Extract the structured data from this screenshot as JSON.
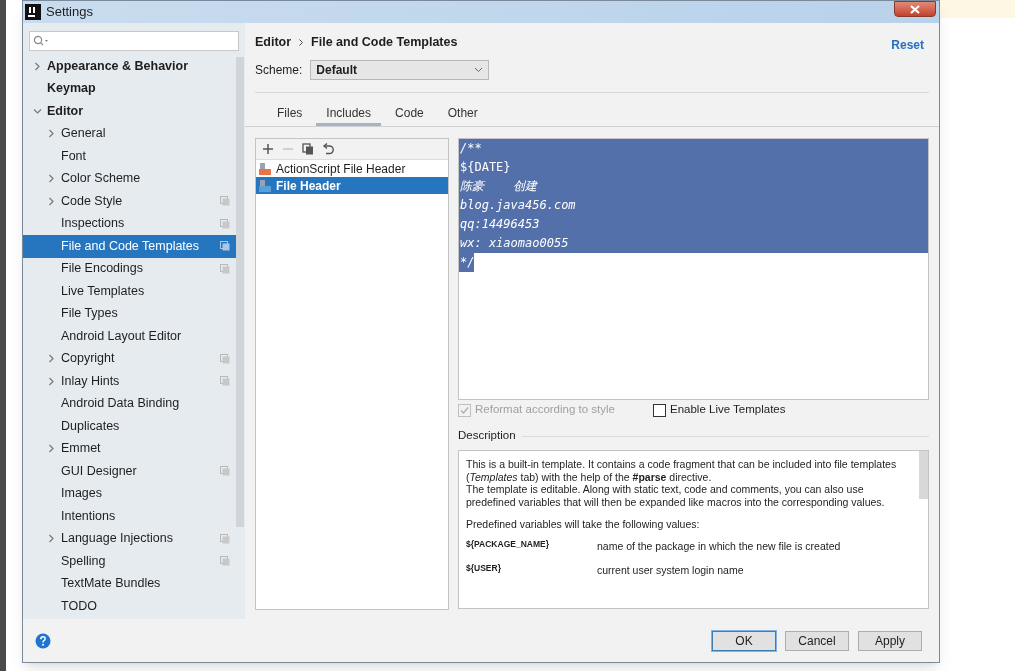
{
  "window": {
    "title": "Settings"
  },
  "sidebar": {
    "items": [
      {
        "label": "Appearance & Behavior",
        "selected": false,
        "expanded": false
      },
      {
        "label": "Keymap",
        "selected": false
      },
      {
        "label": "Editor",
        "selected": false,
        "expanded": true,
        "children": [
          {
            "label": "General",
            "selected": false,
            "expanded": false
          },
          {
            "label": "Font",
            "selected": false
          },
          {
            "label": "Color Scheme",
            "selected": false,
            "expanded": false
          },
          {
            "label": "Code Style",
            "selected": false,
            "expanded": false,
            "project_level": true
          },
          {
            "label": "Inspections",
            "selected": false,
            "project_level": true
          },
          {
            "label": "File and Code Templates",
            "selected": true,
            "project_level": true
          },
          {
            "label": "File Encodings",
            "selected": false,
            "project_level": true
          },
          {
            "label": "Live Templates",
            "selected": false
          },
          {
            "label": "File Types",
            "selected": false
          },
          {
            "label": "Android Layout Editor",
            "selected": false
          },
          {
            "label": "Copyright",
            "selected": false,
            "expanded": false,
            "project_level": true
          },
          {
            "label": "Inlay Hints",
            "selected": false,
            "expanded": false,
            "project_level": true
          },
          {
            "label": "Android Data Binding",
            "selected": false
          },
          {
            "label": "Duplicates",
            "selected": false
          },
          {
            "label": "Emmet",
            "selected": false,
            "expanded": false
          },
          {
            "label": "GUI Designer",
            "selected": false,
            "project_level": true
          },
          {
            "label": "Images",
            "selected": false
          },
          {
            "label": "Intentions",
            "selected": false
          },
          {
            "label": "Language Injections",
            "selected": false,
            "expanded": false,
            "project_level": true
          },
          {
            "label": "Spelling",
            "selected": false,
            "project_level": true
          },
          {
            "label": "TextMate Bundles",
            "selected": false
          },
          {
            "label": "TODO",
            "selected": false
          }
        ]
      }
    ]
  },
  "breadcrumb": [
    "Editor",
    "File and Code Templates"
  ],
  "reset": "Reset",
  "scheme": {
    "label": "Scheme:",
    "value": "Default"
  },
  "tabs": [
    {
      "label": "Files",
      "selected": false
    },
    {
      "label": "Includes",
      "selected": true
    },
    {
      "label": "Code",
      "selected": false
    },
    {
      "label": "Other",
      "selected": false
    }
  ],
  "toolbar": [
    {
      "kind": "add",
      "disabled": false
    },
    {
      "kind": "remove",
      "disabled": true
    },
    {
      "kind": "copy",
      "disabled": false
    },
    {
      "kind": "reset",
      "disabled": false
    }
  ],
  "templates": [
    {
      "name": "ActionScript File Header",
      "kind": "actionscript",
      "selected": false
    },
    {
      "name": "File Header",
      "kind": "java",
      "selected": true
    }
  ],
  "editor": {
    "lines": [
      {
        "text": "/**",
        "kind": "comment",
        "selected": true,
        "whole_line": true
      },
      {
        "text": "${DATE}",
        "kind": "variable",
        "selected": true,
        "whole_line": true
      },
      {
        "text": "陈豪    创建",
        "kind": "comment",
        "selected": true,
        "whole_line": true
      },
      {
        "text": "blog.java456.com",
        "kind": "comment",
        "selected": true,
        "whole_line": true
      },
      {
        "text": "qq:14496453",
        "kind": "comment",
        "selected": true,
        "whole_line": true
      },
      {
        "text": "wx: xiaomao0055",
        "kind": "comment",
        "selected": true,
        "whole_line": true
      },
      {
        "text": "*/",
        "kind": "comment",
        "selected": true,
        "whole_line": false
      }
    ]
  },
  "options": [
    {
      "label": "Reformat according to style",
      "checked": true,
      "disabled": true
    },
    {
      "label": "Enable Live Templates",
      "checked": false,
      "disabled": false
    }
  ],
  "description": {
    "title": "Description",
    "paragraphs": [
      "This is a built-in template. It contains a code fragment that can be included into file templates (*Templates* tab) with the help of the **#parse** directive.",
      "The template is editable. Along with static text, code and comments, you can also use predefined variables that will then be expanded like macros into the corresponding values.",
      "Predefined variables will take the following values:"
    ],
    "variables": [
      {
        "name": "${PACKAGE_NAME}",
        "text": "name of the package in which the new file is created"
      },
      {
        "name": "${USER}",
        "text": "current user system login name"
      }
    ]
  },
  "buttons": [
    {
      "label": "OK",
      "default": true
    },
    {
      "label": "Cancel",
      "default": false
    },
    {
      "label": "Apply",
      "default": false
    }
  ]
}
